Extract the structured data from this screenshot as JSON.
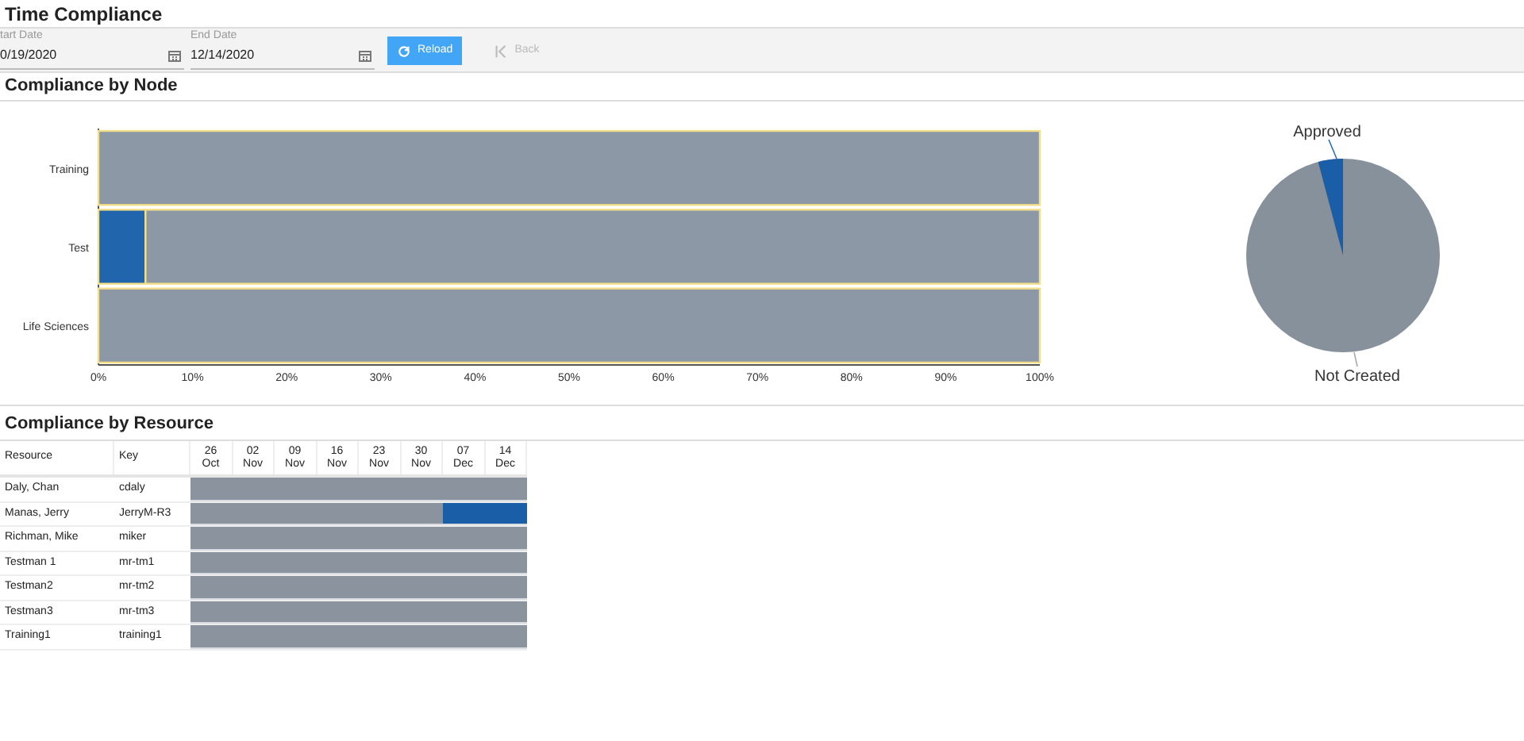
{
  "page_title": "Time Compliance",
  "filters": {
    "start_date": {
      "label": "tart Date",
      "value": "0/19/2020"
    },
    "end_date": {
      "label": "End Date",
      "value": "12/14/2020"
    },
    "buttons": [
      {
        "label": "Reload",
        "disabled": false
      },
      {
        "label": "Back",
        "disabled": true
      }
    ]
  },
  "node_section": {
    "title": "Compliance by Node",
    "chart_data": {
      "type": "bar",
      "orientation": "horizontal",
      "stacked": true,
      "categories": [
        "Training",
        "Test",
        "Life Sciences"
      ],
      "series": [
        {
          "color": "#2166ac",
          "values": [
            0,
            5,
            0
          ]
        },
        {
          "color": "#8c98a5",
          "values": [
            100,
            95,
            100
          ]
        }
      ],
      "xlim": [
        0,
        100
      ],
      "xticks": [
        {
          "value": 0,
          "label": "0%"
        },
        {
          "value": 10,
          "label": "10%"
        },
        {
          "value": 20,
          "label": "20%"
        },
        {
          "value": 30,
          "label": "30%"
        },
        {
          "value": 40,
          "label": "40%"
        },
        {
          "value": 50,
          "label": "50%"
        },
        {
          "value": 60,
          "label": "60%"
        },
        {
          "value": 70,
          "label": "70%"
        },
        {
          "value": 80,
          "label": "80%"
        },
        {
          "value": 90,
          "label": "90%"
        },
        {
          "value": 100,
          "label": "100%"
        }
      ]
    },
    "pie": {
      "labels": [
        "Approved",
        "Not Created"
      ]
    }
  },
  "resource_section": {
    "title": "Compliance by Resource",
    "columns": [
      "Resource",
      "Key"
    ],
    "weeks": [
      {
        "day": "26",
        "month": "Oct"
      },
      {
        "day": "02",
        "month": "Nov"
      },
      {
        "day": "09",
        "month": "Nov"
      },
      {
        "day": "16",
        "month": "Nov"
      },
      {
        "day": "23",
        "month": "Nov"
      },
      {
        "day": "30",
        "month": "Nov"
      },
      {
        "day": "07",
        "month": "Dec"
      },
      {
        "day": "14",
        "month": "Dec"
      }
    ],
    "rows": [
      {
        "resource": "Daly, Chan",
        "key": "cdaly",
        "approved_weeks": [
          false,
          false,
          false,
          false,
          false,
          false,
          false,
          false
        ]
      },
      {
        "resource": "Manas, Jerry",
        "key": "JerryM-R3",
        "approved_weeks": [
          false,
          false,
          false,
          false,
          false,
          false,
          true,
          true
        ]
      },
      {
        "resource": "Richman, Mike",
        "key": "miker",
        "approved_weeks": [
          false,
          false,
          false,
          false,
          false,
          false,
          false,
          false
        ]
      },
      {
        "resource": "Testman 1",
        "key": "mr-tm1",
        "approved_weeks": [
          false,
          false,
          false,
          false,
          false,
          false,
          false,
          false
        ]
      },
      {
        "resource": "Testman2",
        "key": "mr-tm2",
        "approved_weeks": [
          false,
          false,
          false,
          false,
          false,
          false,
          false,
          false
        ]
      },
      {
        "resource": "Testman3",
        "key": "mr-tm3",
        "approved_weeks": [
          false,
          false,
          false,
          false,
          false,
          false,
          false,
          false
        ]
      },
      {
        "resource": "Training1",
        "key": "training1",
        "approved_weeks": [
          false,
          false,
          false,
          false,
          false,
          false,
          false,
          false
        ]
      }
    ]
  }
}
